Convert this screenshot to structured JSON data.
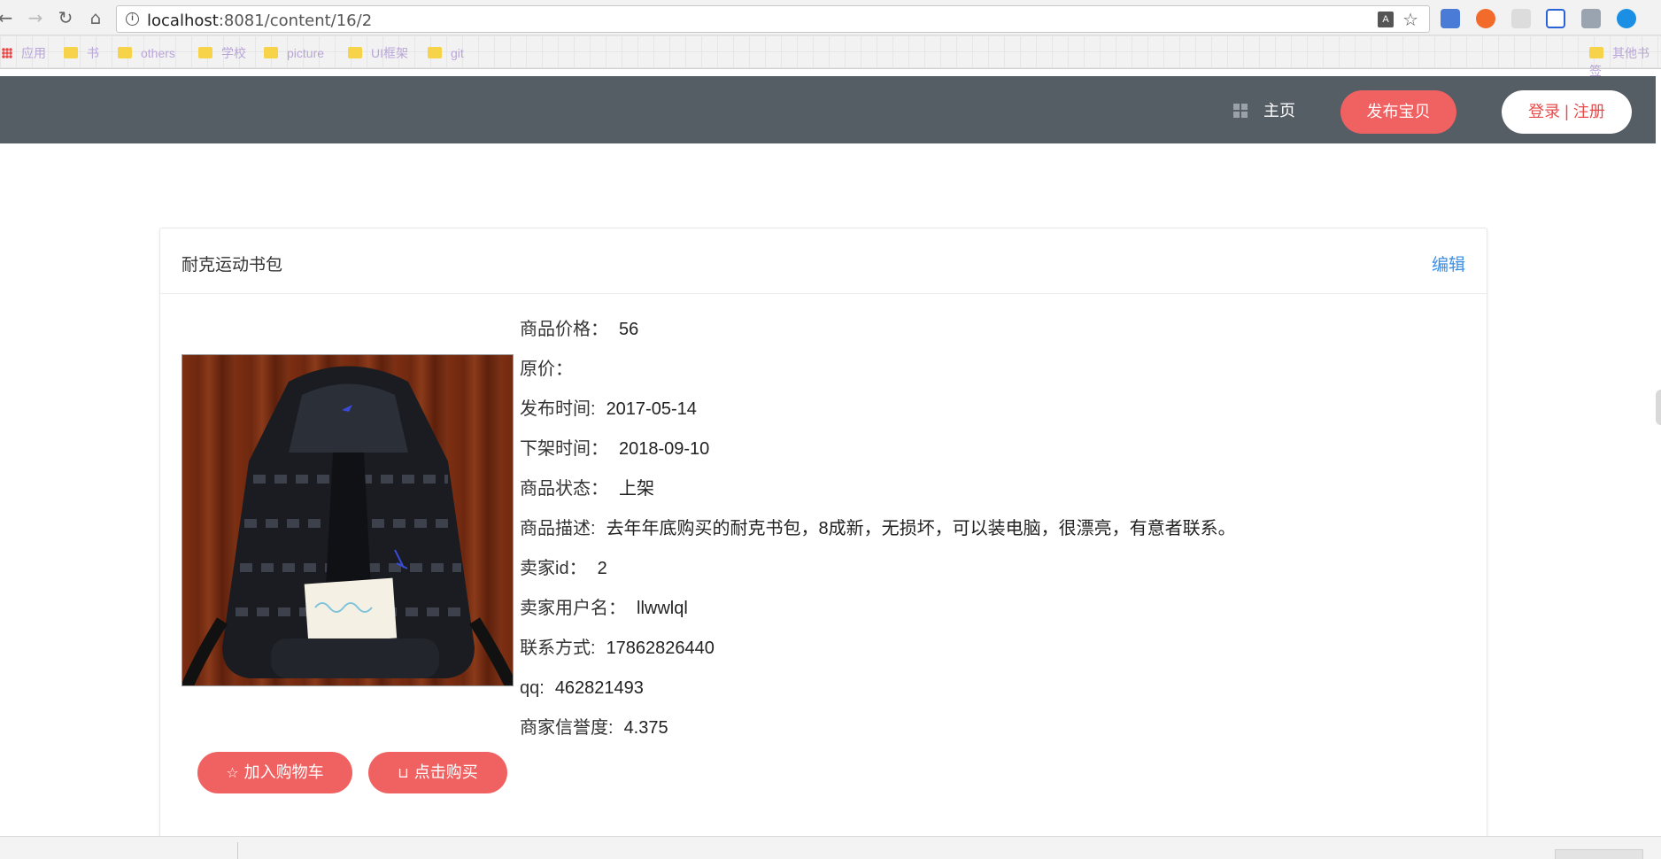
{
  "browser": {
    "url_host": "localhost",
    "url_path": ":8081/content/16/2",
    "bookmarks": [
      "应用",
      "书",
      "others",
      "学校",
      "picture",
      "UI框架",
      "git",
      "其他书签"
    ]
  },
  "header": {
    "home_label": "主页",
    "publish_label": "发布宝贝",
    "login_label": "登录",
    "divider": "|",
    "register_label": "注册"
  },
  "product": {
    "title": "耐克运动书包",
    "edit_label": "编辑",
    "details": [
      {
        "label": "商品价格：",
        "value": "56"
      },
      {
        "label": "原价：",
        "value": ""
      },
      {
        "label": "发布时间:",
        "value": "2017-05-14"
      },
      {
        "label": "下架时间：",
        "value": "2018-09-10"
      },
      {
        "label": "商品状态：",
        "value": "上架"
      },
      {
        "label": "商品描述:",
        "value": "去年年底购买的耐克书包，8成新，无损坏，可以装电脑，很漂亮，有意者联系。"
      },
      {
        "label": "卖家id：",
        "value": "2"
      },
      {
        "label": "卖家用户名：",
        "value": "llwwlql"
      },
      {
        "label": "联系方式:",
        "value": "17862826440"
      },
      {
        "label": "qq:",
        "value": "462821493"
      },
      {
        "label": "商家信誉度:",
        "value": "4.375"
      }
    ],
    "add_to_cart_label": "加入购物车",
    "buy_label": "点击购买"
  },
  "colors": {
    "header_bg": "#555d65",
    "accent": "#f06262",
    "link": "#3a8ee6"
  },
  "icons": {
    "home": "grid-icon",
    "cart": "star-icon",
    "buy": "shopping-bag-icon"
  }
}
